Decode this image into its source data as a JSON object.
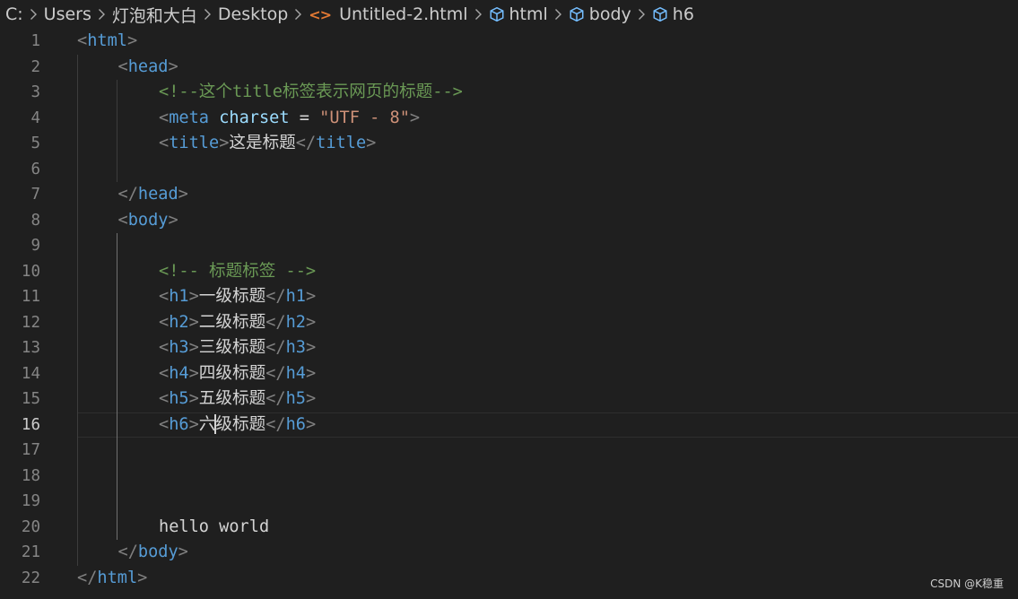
{
  "breadcrumb": {
    "items": [
      {
        "label": "C:",
        "icon": ""
      },
      {
        "label": "Users",
        "icon": ""
      },
      {
        "label": "灯泡和大白",
        "icon": ""
      },
      {
        "label": "Desktop",
        "icon": ""
      },
      {
        "label": "Untitled-2.html",
        "icon": "html-file-icon"
      },
      {
        "label": "html",
        "icon": "symbol-element-icon"
      },
      {
        "label": "body",
        "icon": "symbol-element-icon"
      },
      {
        "label": "h6",
        "icon": "symbol-element-icon"
      }
    ],
    "separator_icon": "chevron-right-icon"
  },
  "editor": {
    "current_line": 16,
    "line_numbers": [
      "1",
      "2",
      "3",
      "4",
      "5",
      "6",
      "7",
      "8",
      "9",
      "10",
      "11",
      "12",
      "13",
      "14",
      "15",
      "16",
      "17",
      "18",
      "19",
      "20",
      "21",
      "22"
    ],
    "lines": [
      {
        "n": 1,
        "tokens": [
          [
            "p",
            "<"
          ],
          [
            "tag",
            "html"
          ],
          [
            "p",
            ">"
          ]
        ]
      },
      {
        "n": 2,
        "tokens": [
          [
            "p",
            "<"
          ],
          [
            "tag",
            "head"
          ],
          [
            "p",
            ">"
          ]
        ]
      },
      {
        "n": 3,
        "tokens": [
          [
            "cmt",
            "<!--这个title标签表示网页的标题-->"
          ]
        ]
      },
      {
        "n": 4,
        "tokens": [
          [
            "p",
            "<"
          ],
          [
            "tag",
            "meta"
          ],
          [
            "txt",
            " "
          ],
          [
            "attr",
            "charset"
          ],
          [
            "txt",
            " = "
          ],
          [
            "str",
            "\"UTF - 8\""
          ],
          [
            "p",
            ">"
          ]
        ]
      },
      {
        "n": 5,
        "tokens": [
          [
            "p",
            "<"
          ],
          [
            "tag",
            "title"
          ],
          [
            "p",
            ">"
          ],
          [
            "txt",
            "这是标题"
          ],
          [
            "p",
            "</"
          ],
          [
            "tag",
            "title"
          ],
          [
            "p",
            ">"
          ]
        ]
      },
      {
        "n": 6,
        "tokens": []
      },
      {
        "n": 7,
        "tokens": [
          [
            "p",
            "</"
          ],
          [
            "tag",
            "head"
          ],
          [
            "p",
            ">"
          ]
        ]
      },
      {
        "n": 8,
        "tokens": [
          [
            "p",
            "<"
          ],
          [
            "tag",
            "body"
          ],
          [
            "p",
            ">"
          ]
        ]
      },
      {
        "n": 9,
        "tokens": []
      },
      {
        "n": 10,
        "tokens": [
          [
            "cmt",
            "<!-- 标题标签 -->"
          ]
        ]
      },
      {
        "n": 11,
        "tokens": [
          [
            "p",
            "<"
          ],
          [
            "tag",
            "h1"
          ],
          [
            "p",
            ">"
          ],
          [
            "txt",
            "一级标题"
          ],
          [
            "p",
            "</"
          ],
          [
            "tag",
            "h1"
          ],
          [
            "p",
            ">"
          ]
        ]
      },
      {
        "n": 12,
        "tokens": [
          [
            "p",
            "<"
          ],
          [
            "tag",
            "h2"
          ],
          [
            "p",
            ">"
          ],
          [
            "txt",
            "二级标题"
          ],
          [
            "p",
            "</"
          ],
          [
            "tag",
            "h2"
          ],
          [
            "p",
            ">"
          ]
        ]
      },
      {
        "n": 13,
        "tokens": [
          [
            "p",
            "<"
          ],
          [
            "tag",
            "h3"
          ],
          [
            "p",
            ">"
          ],
          [
            "txt",
            "三级标题"
          ],
          [
            "p",
            "</"
          ],
          [
            "tag",
            "h3"
          ],
          [
            "p",
            ">"
          ]
        ]
      },
      {
        "n": 14,
        "tokens": [
          [
            "p",
            "<"
          ],
          [
            "tag",
            "h4"
          ],
          [
            "p",
            ">"
          ],
          [
            "txt",
            "四级标题"
          ],
          [
            "p",
            "</"
          ],
          [
            "tag",
            "h4"
          ],
          [
            "p",
            ">"
          ]
        ]
      },
      {
        "n": 15,
        "tokens": [
          [
            "p",
            "<"
          ],
          [
            "tag",
            "h5"
          ],
          [
            "p",
            ">"
          ],
          [
            "txt",
            "五级标题"
          ],
          [
            "p",
            "</"
          ],
          [
            "tag",
            "h5"
          ],
          [
            "p",
            ">"
          ]
        ]
      },
      {
        "n": 16,
        "tokens": [
          [
            "p",
            "<"
          ],
          [
            "tag",
            "h6"
          ],
          [
            "p",
            ">"
          ],
          [
            "txt",
            "六"
          ],
          [
            "cursor",
            ""
          ],
          [
            "txt",
            "级标题"
          ],
          [
            "p",
            "</"
          ],
          [
            "tag",
            "h6"
          ],
          [
            "p",
            ">"
          ]
        ]
      },
      {
        "n": 17,
        "tokens": []
      },
      {
        "n": 18,
        "tokens": []
      },
      {
        "n": 19,
        "tokens": []
      },
      {
        "n": 20,
        "tokens": [
          [
            "txt",
            "hello world"
          ]
        ]
      },
      {
        "n": 21,
        "tokens": [
          [
            "p",
            "</"
          ],
          [
            "tag",
            "body"
          ],
          [
            "p",
            ">"
          ]
        ]
      },
      {
        "n": 22,
        "tokens": [
          [
            "p",
            "</"
          ],
          [
            "tag",
            "html"
          ],
          [
            "p",
            ">"
          ]
        ]
      }
    ]
  },
  "watermark": "CSDN @K稳重",
  "colors": {
    "background": "#1f1f1f",
    "tag": "#569cd6",
    "attribute": "#9cdcfe",
    "string": "#ce9178",
    "comment": "#6a9955",
    "punctuation": "#808080",
    "text": "#d4d4d4"
  }
}
